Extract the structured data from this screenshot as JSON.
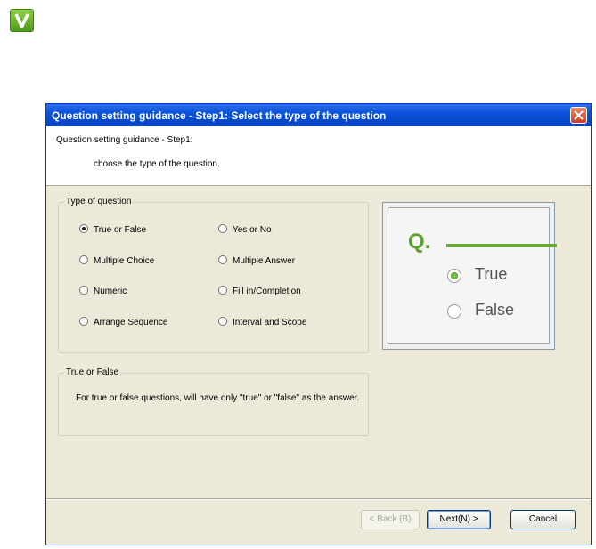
{
  "logo": {
    "icon": "v-logo-icon"
  },
  "window": {
    "title": "Question setting guidance - Step1: Select the type of the question",
    "close_icon": "close-icon"
  },
  "header": {
    "line1": "Question setting guidance - Step1:",
    "line2": "choose the type of the question."
  },
  "type_group": {
    "legend": "Type of question",
    "options": [
      {
        "label": "True or False",
        "selected": true
      },
      {
        "label": "Yes or No",
        "selected": false
      },
      {
        "label": "Multiple Choice",
        "selected": false
      },
      {
        "label": "Multiple Answer",
        "selected": false
      },
      {
        "label": "Numeric",
        "selected": false
      },
      {
        "label": "Fill in/Completion",
        "selected": false
      },
      {
        "label": "Arrange Sequence",
        "selected": false
      },
      {
        "label": "Interval and Scope",
        "selected": false
      }
    ]
  },
  "desc_group": {
    "legend": "True or False",
    "text": "For true or false questions, will have only \"true\" or \"false\" as the answer."
  },
  "preview": {
    "q_label": "Q.",
    "true_label": "True",
    "false_label": "False"
  },
  "buttons": {
    "back": "< Back (B)",
    "next": "Next(N) >",
    "cancel": "Cancel"
  },
  "colors": {
    "title_bar": "#0a53d9",
    "dialog_bg": "#ece9d8",
    "accent_green": "#6aaa35"
  }
}
